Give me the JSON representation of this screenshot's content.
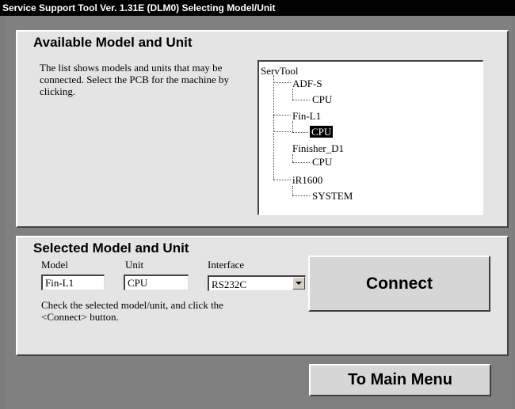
{
  "window": {
    "title": "Service Support Tool Ver. 1.31E (DLM0)   Selecting Model/Unit"
  },
  "available": {
    "title": "Available Model and Unit",
    "description": "The list shows models and units that may be connected. Select the PCB for the machine by clicking.",
    "tree": {
      "root": "ServTool",
      "nodes": [
        {
          "label": "ADF-S",
          "children": [
            "CPU"
          ]
        },
        {
          "label": "Fin-L1",
          "children": [
            "CPU"
          ],
          "selected_child": "CPU"
        },
        {
          "label": "Finisher_D1",
          "children": [
            "CPU"
          ]
        },
        {
          "label": "iR1600",
          "children": [
            "SYSTEM"
          ]
        }
      ]
    }
  },
  "selected": {
    "title": "Selected Model and Unit",
    "model_label": "Model",
    "unit_label": "Unit",
    "interface_label": "Interface",
    "model_value": "Fin-L1",
    "unit_value": "CPU",
    "interface_value": "RS232C",
    "instructions": "Check the selected model/unit, and click the <Connect> button."
  },
  "buttons": {
    "connect": "Connect",
    "main_menu": "To Main Menu"
  }
}
